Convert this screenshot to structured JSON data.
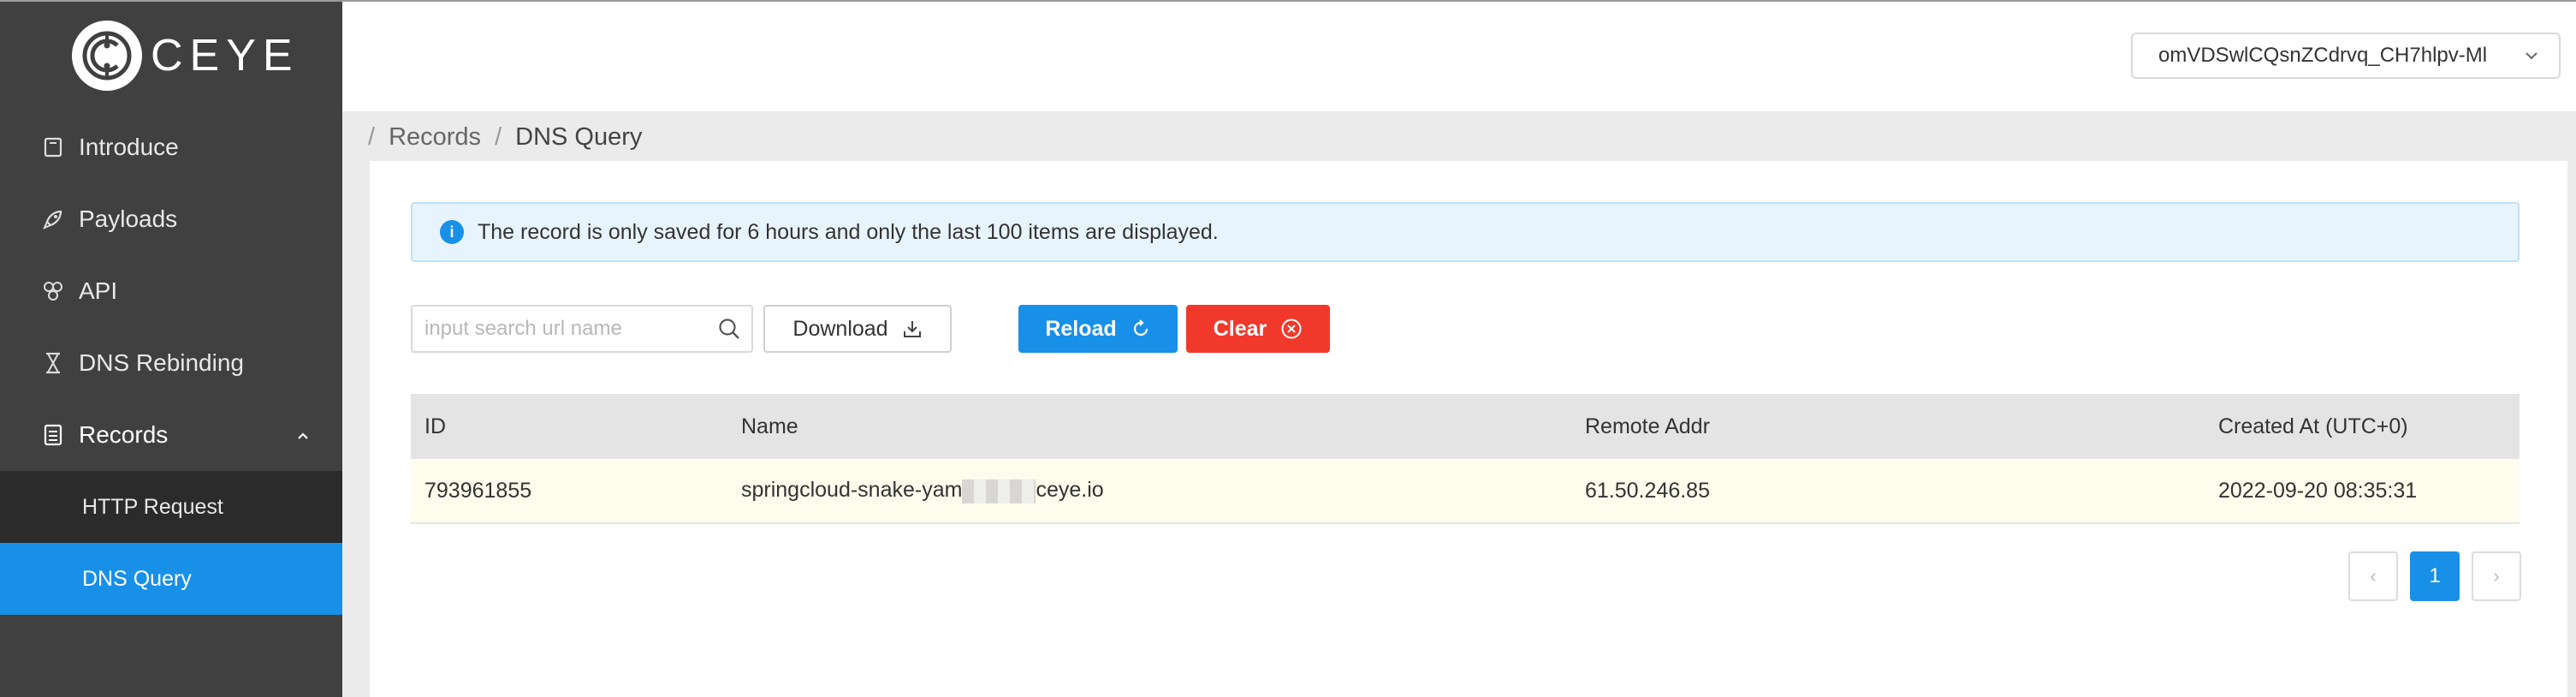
{
  "brand": {
    "name": "CEYE"
  },
  "sidebar": {
    "items": [
      {
        "label": "Introduce",
        "icon": "book-icon"
      },
      {
        "label": "Payloads",
        "icon": "rocket-icon"
      },
      {
        "label": "API",
        "icon": "api-icon"
      },
      {
        "label": "DNS Rebinding",
        "icon": "hourglass-icon"
      },
      {
        "label": "Records",
        "icon": "records-icon",
        "expanded": true
      }
    ],
    "subitems": [
      {
        "label": "HTTP Request",
        "selected": false
      },
      {
        "label": "DNS Query",
        "selected": true
      }
    ]
  },
  "header": {
    "token": "omVDSwlCQsnZCdrvq_CH7hlpv-Ml"
  },
  "breadcrumb": {
    "sep": "/",
    "parent": "Records",
    "current": "DNS Query"
  },
  "alert": {
    "text": "The record is only saved for 6 hours and only the last 100 items are displayed."
  },
  "toolbar": {
    "search_placeholder": "input search url name",
    "download_label": "Download",
    "reload_label": "Reload",
    "clear_label": "Clear"
  },
  "table": {
    "headers": [
      "ID",
      "Name",
      "Remote Addr",
      "Created At (UTC+0)"
    ],
    "rows": [
      {
        "id": "793961855",
        "name_prefix": "springcloud-snake-yam",
        "name_suffix": "ceye.io",
        "remote_addr": "61.50.246.85",
        "created_at": "2022-09-20 08:35:31"
      }
    ]
  },
  "pagination": {
    "current": "1",
    "prev": "‹",
    "next": "›"
  },
  "colors": {
    "sidebar": "#404040",
    "submenu": "#2b2b2b",
    "primary": "#1890e8",
    "danger": "#f0392b",
    "alert_bg": "#e8f4fd",
    "row_highlight": "#fefcec"
  }
}
